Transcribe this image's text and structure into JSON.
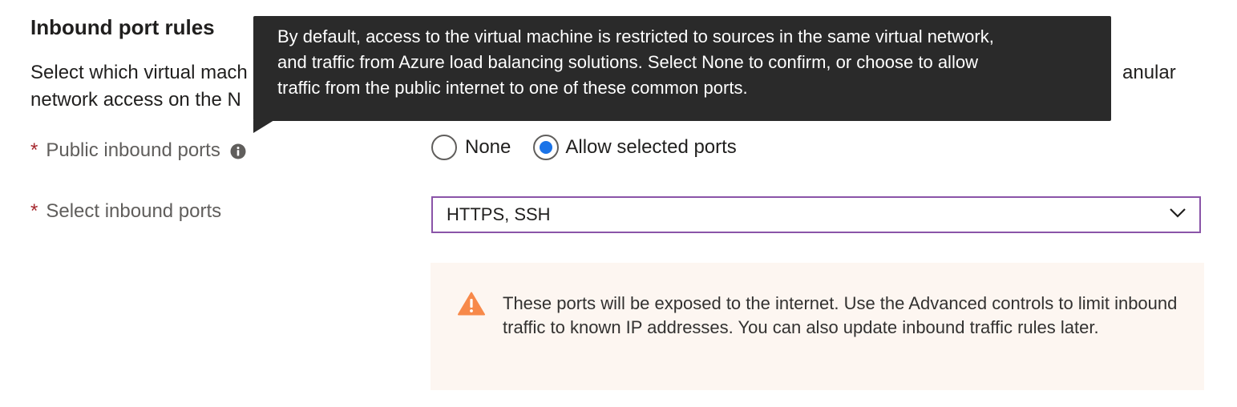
{
  "section": {
    "title": "Inbound port rules",
    "description_line1": "Select which virtual mach",
    "description_line2": "network access on the N",
    "description_tail": "anular"
  },
  "public_ports": {
    "required_mark": "*",
    "label": "Public inbound ports",
    "info_icon": "info-icon",
    "options": [
      {
        "label": "None",
        "selected": false
      },
      {
        "label": "Allow selected ports",
        "selected": true
      }
    ]
  },
  "select_ports": {
    "required_mark": "*",
    "label": "Select inbound ports",
    "value": "HTTPS, SSH",
    "chevron_icon": "chevron-down-icon"
  },
  "warning": {
    "icon": "warning-icon",
    "text": "These ports will be exposed to the internet. Use the Advanced controls to limit inbound traffic to known IP addresses. You can also update inbound traffic rules later."
  },
  "tooltip": {
    "line1": "By default, access to the virtual machine is restricted to sources in the same virtual network,",
    "line2": "and traffic from Azure load balancing solutions. Select None to confirm, or choose to allow",
    "line3": "traffic from the public internet to one of these common ports."
  },
  "colors": {
    "radio_selected": "#1a73e8",
    "dropdown_border_focus": "#8a54a8",
    "required": "#a4262c",
    "warning_bg": "#fdf6f1",
    "warning_icon": "#f7894a",
    "tooltip_bg": "#2a2a2a"
  }
}
